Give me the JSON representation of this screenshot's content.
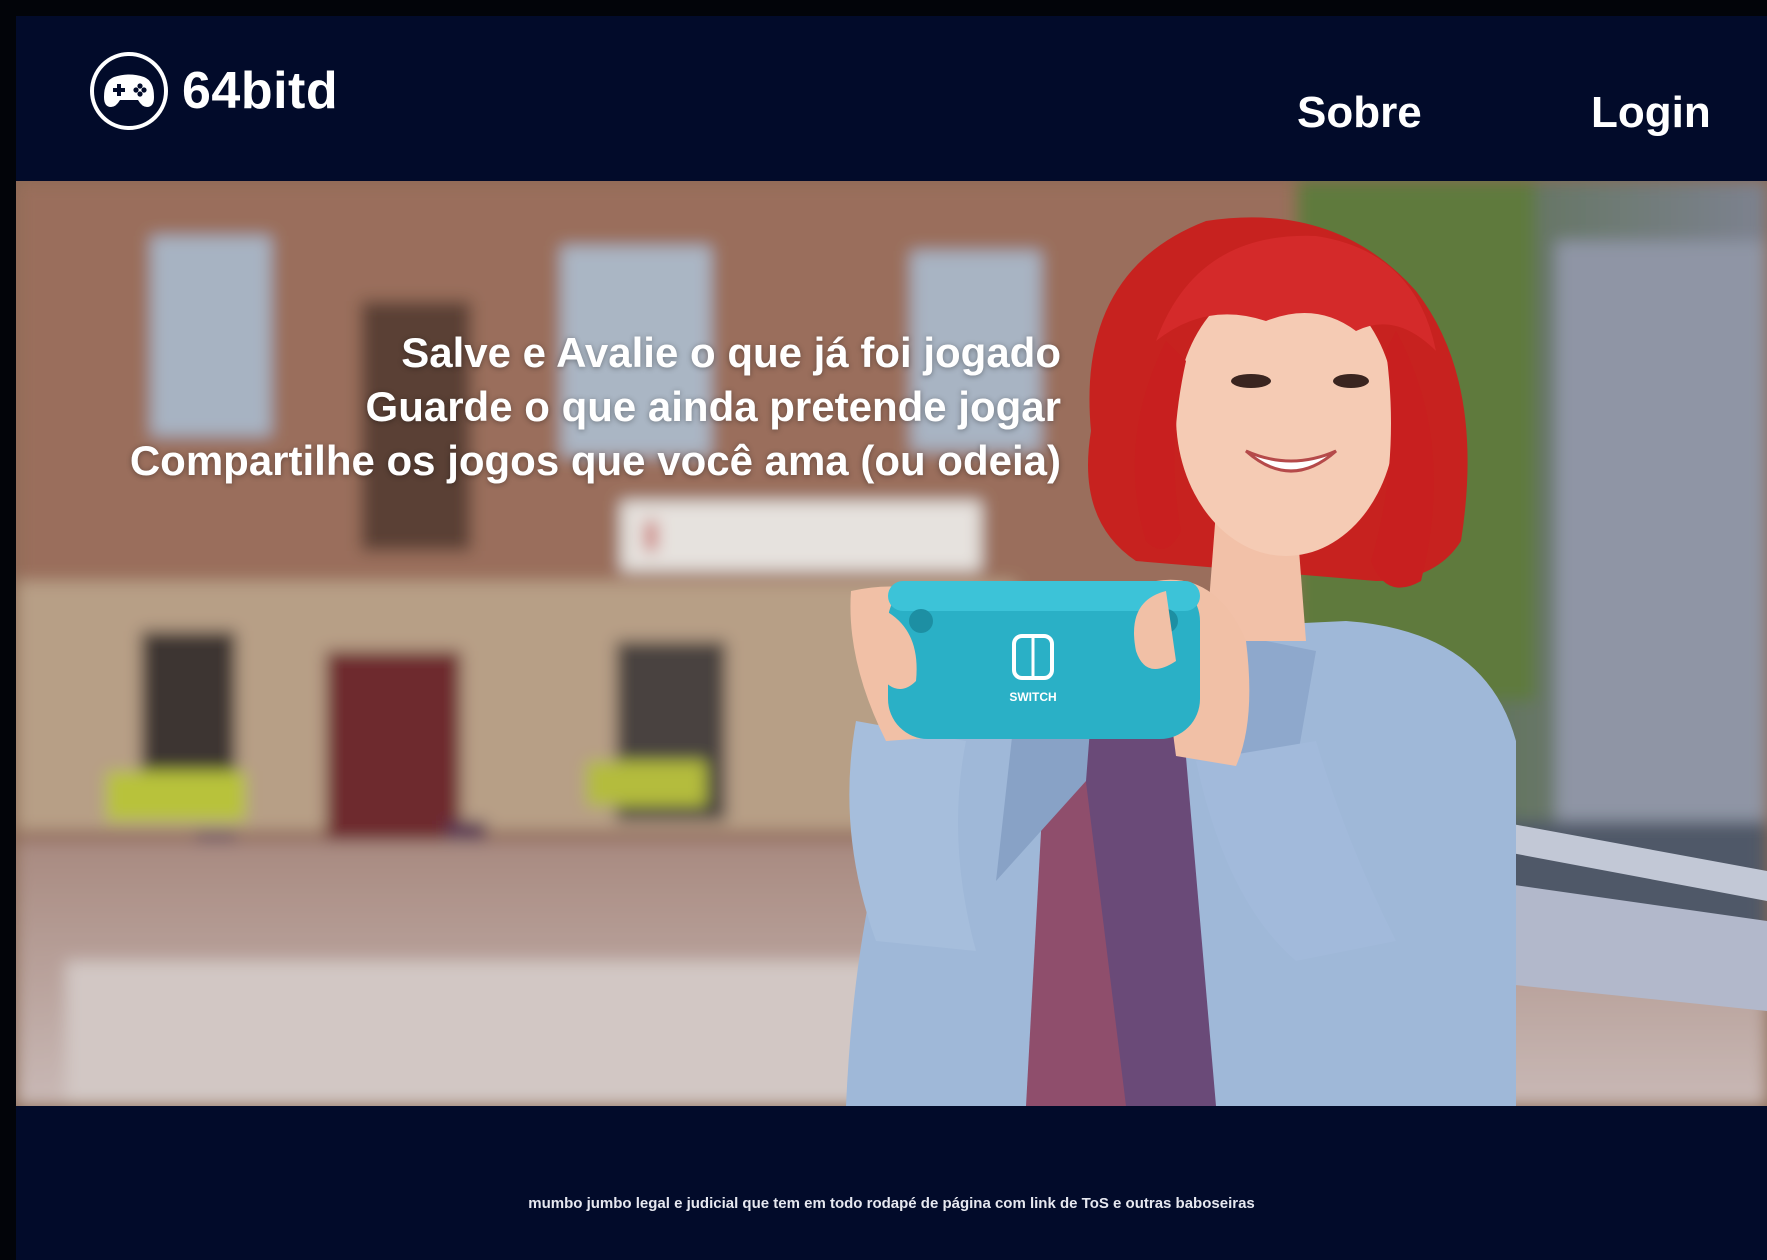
{
  "brand": {
    "name": "64bitd",
    "icon": "gamepad-icon"
  },
  "nav": {
    "about_label": "Sobre",
    "login_label": "Login"
  },
  "hero": {
    "lines": [
      "Salve e Avalie o que já foi jogado",
      "Guarde o que ainda pretende jogar",
      "Compartilhe os jogos que você ama (ou odeia)"
    ],
    "image_description_icon": "person-playing-handheld-console",
    "console_text": "SWITCH"
  },
  "footer": {
    "text": "mumbo jumbo legal e judicial que tem em todo rodapé de página com link de ToS e outras baboseiras"
  },
  "colors": {
    "background": "#020b2a",
    "text": "#ffffff",
    "accent": "#4b45c8",
    "console": "#2ab0c6",
    "hair": "#d42a2a",
    "jacket": "#9fb8d8"
  }
}
